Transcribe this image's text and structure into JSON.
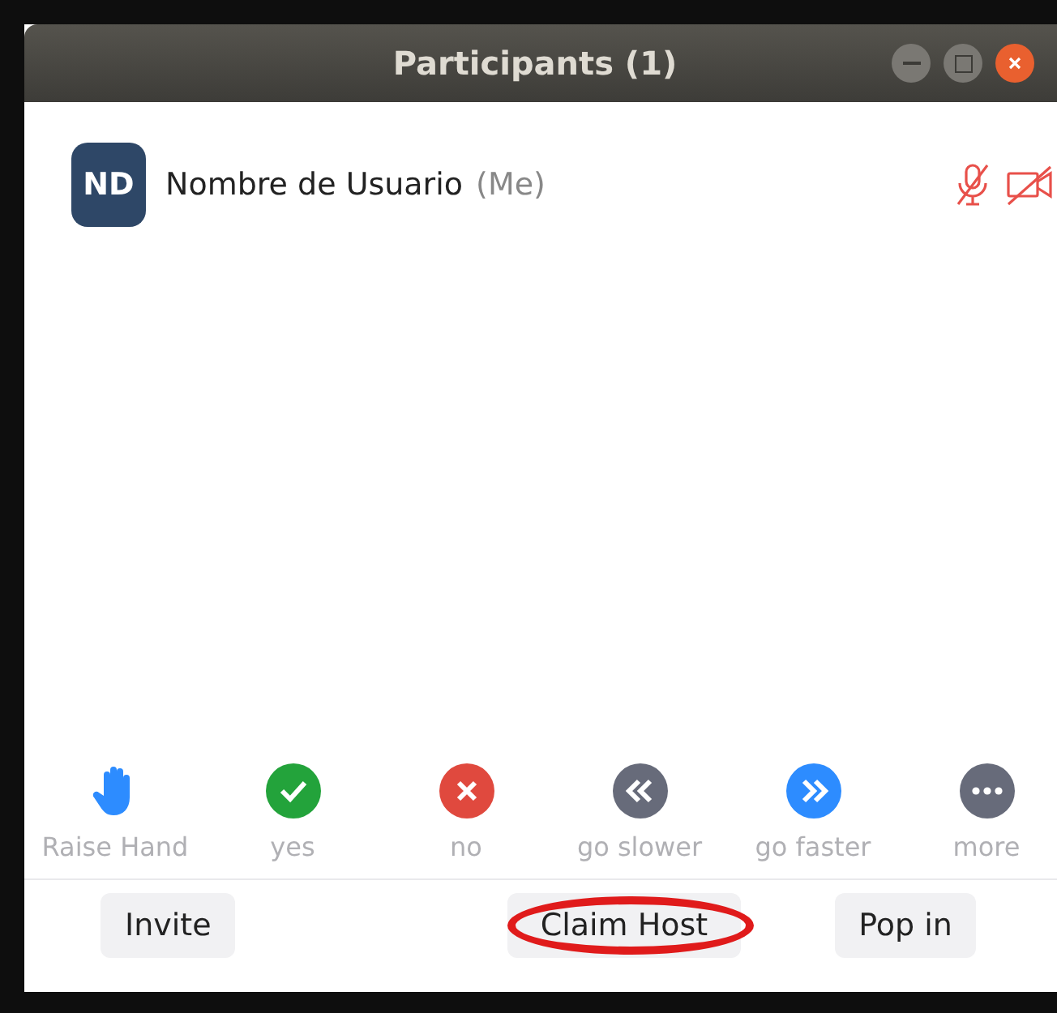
{
  "window": {
    "title": "Participants (1)"
  },
  "participants": [
    {
      "initials": "ND",
      "name": "Nombre de Usuario",
      "tag": "(Me)",
      "audio_muted": true,
      "video_off": true
    }
  ],
  "reactions": [
    {
      "kind": "hand",
      "label": "Raise Hand"
    },
    {
      "kind": "yes",
      "label": "yes"
    },
    {
      "kind": "no",
      "label": "no"
    },
    {
      "kind": "slower",
      "label": "go slower"
    },
    {
      "kind": "faster",
      "label": "go faster"
    },
    {
      "kind": "more",
      "label": "more"
    }
  ],
  "buttons": [
    {
      "label": "Invite",
      "highlighted": false
    },
    {
      "label": "Claim Host",
      "highlighted": true
    },
    {
      "label": "Pop in",
      "highlighted": false
    }
  ]
}
